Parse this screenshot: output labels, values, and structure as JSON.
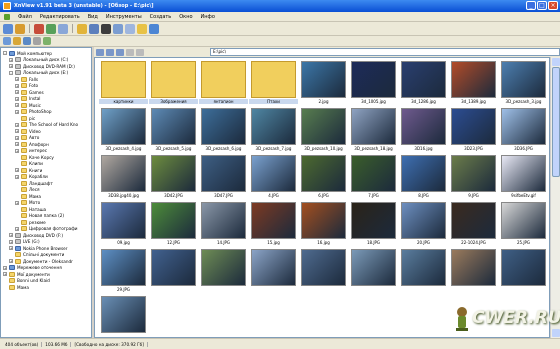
{
  "window": {
    "title": "XnView v1.91 beta 3 (unstable) - [Обзор - E:\\pic\\]"
  },
  "menu": [
    "Файл",
    "Редактировать",
    "Вид",
    "Инструменты",
    "Создать",
    "Окно",
    "Инфо"
  ],
  "address": {
    "value": "E:\\pic\\"
  },
  "tree": [
    {
      "label": "Мой компьютер",
      "depth": 0,
      "kind": "pc",
      "expander": "-"
    },
    {
      "label": "Локальный диск (C:)",
      "depth": 1,
      "kind": "drive",
      "expander": "+"
    },
    {
      "label": "Дисковод DVD-RAM (D:)",
      "depth": 1,
      "kind": "drive",
      "expander": "+"
    },
    {
      "label": "Локальный диск (E:)",
      "depth": 1,
      "kind": "drive",
      "expander": "-"
    },
    {
      "label": "Falls",
      "depth": 2,
      "kind": "folder",
      "expander": "+"
    },
    {
      "label": "Foto",
      "depth": 2,
      "kind": "folder",
      "expander": "+"
    },
    {
      "label": "Games",
      "depth": 2,
      "kind": "folder",
      "expander": "+"
    },
    {
      "label": "Instal",
      "depth": 2,
      "kind": "folder",
      "expander": "+"
    },
    {
      "label": "Music",
      "depth": 2,
      "kind": "folder",
      "expander": "+"
    },
    {
      "label": "PhotoShop",
      "depth": 2,
      "kind": "folder",
      "expander": "+"
    },
    {
      "label": "pic",
      "depth": 2,
      "kind": "folder",
      "expander": ""
    },
    {
      "label": "The School of Hard Kno",
      "depth": 2,
      "kind": "folder",
      "expander": "+"
    },
    {
      "label": "Video",
      "depth": 2,
      "kind": "folder",
      "expander": "+"
    },
    {
      "label": "Авто",
      "depth": 2,
      "kind": "folder",
      "expander": "+"
    },
    {
      "label": "Апофорн",
      "depth": 2,
      "kind": "folder",
      "expander": "+"
    },
    {
      "label": "интерес",
      "depth": 2,
      "kind": "folder",
      "expander": "+"
    },
    {
      "label": "Каче Корсу",
      "depth": 2,
      "kind": "folder",
      "expander": ""
    },
    {
      "label": "Клипи",
      "depth": 2,
      "kind": "folder",
      "expander": ""
    },
    {
      "label": "Книги",
      "depth": 2,
      "kind": "folder",
      "expander": "+"
    },
    {
      "label": "Корабли",
      "depth": 2,
      "kind": "folder",
      "expander": "+"
    },
    {
      "label": "Ландшафт",
      "depth": 2,
      "kind": "folder",
      "expander": ""
    },
    {
      "label": "Леся",
      "depth": 2,
      "kind": "folder",
      "expander": ""
    },
    {
      "label": "Мама",
      "depth": 2,
      "kind": "folder",
      "expander": ""
    },
    {
      "label": "Мото",
      "depth": 2,
      "kind": "folder",
      "expander": "+"
    },
    {
      "label": "Наташа",
      "depth": 2,
      "kind": "folder",
      "expander": ""
    },
    {
      "label": "Новая папка (2)",
      "depth": 2,
      "kind": "folder",
      "expander": ""
    },
    {
      "label": "резюме",
      "depth": 2,
      "kind": "folder",
      "expander": ""
    },
    {
      "label": "Цифровая фотографи",
      "depth": 2,
      "kind": "folder",
      "expander": "+"
    },
    {
      "label": "Дисковод DVD (F:)",
      "depth": 1,
      "kind": "drive",
      "expander": "+"
    },
    {
      "label": "LVE (G:)",
      "depth": 1,
      "kind": "drive",
      "expander": "+"
    },
    {
      "label": "Nokia Phone Browser",
      "depth": 1,
      "kind": "pc",
      "expander": "+"
    },
    {
      "label": "Спільні документи",
      "depth": 1,
      "kind": "folder",
      "expander": ""
    },
    {
      "label": "Документи - Oleksandr",
      "depth": 1,
      "kind": "folder",
      "expander": "+"
    },
    {
      "label": "Мережеве оточення",
      "depth": 0,
      "kind": "pc",
      "expander": "+"
    },
    {
      "label": "Мої документи",
      "depth": 0,
      "kind": "folder",
      "expander": "+"
    },
    {
      "label": "Bonni und Klaid",
      "depth": 0,
      "kind": "folder",
      "expander": ""
    },
    {
      "label": "Мама",
      "depth": 0,
      "kind": "folder",
      "expander": ""
    }
  ],
  "thumbnails": [
    {
      "name": "картинки",
      "dir": true,
      "color": "#f1cf5d"
    },
    {
      "name": "Зображения",
      "dir": true,
      "color": "#f1cf5d"
    },
    {
      "name": "янтапион",
      "dir": true,
      "color": "#f1cf5d"
    },
    {
      "name": "Птахи",
      "dir": true,
      "color": "#f1cf5d"
    },
    {
      "name": "2.jpg",
      "color": "#3c77a8"
    },
    {
      "name": "3d_1005.jpg",
      "color": "#1d2b5a"
    },
    {
      "name": "3d_1286.jpg",
      "color": "#2a3f70"
    },
    {
      "name": "3d_1389.jpg",
      "color": "#b34c28"
    },
    {
      "name": "3D_pezsash_3.jpg",
      "color": "#4d7fb0"
    },
    {
      "name": "3D_pezsash_4.jpg",
      "color": "#6fa0c8"
    },
    {
      "name": "3D_pezsash_5.jpg",
      "color": "#5d8ab5"
    },
    {
      "name": "3D_pezsash_6.jpg",
      "color": "#3d6e9a"
    },
    {
      "name": "3D_pezsash_7.jpg",
      "color": "#4f86a3"
    },
    {
      "name": "3D_pezsash_10.jpg",
      "color": "#587d4f"
    },
    {
      "name": "3D_pezsash_18.jpg",
      "color": "#8fa3c2"
    },
    {
      "name": "3D16.jpg",
      "color": "#6f5a8e"
    },
    {
      "name": "3D23.JPG",
      "color": "#2c4d92"
    },
    {
      "name": "3D36.JPG",
      "color": "#9fc0e8"
    },
    {
      "name": "3D38.jpg40.jpg",
      "color": "#b0a8a0"
    },
    {
      "name": "3D42.JPG",
      "color": "#6d8c3e"
    },
    {
      "name": "3D47.JPG",
      "color": "#3e5f84"
    },
    {
      "name": "4.JPG",
      "color": "#7aa1cf"
    },
    {
      "name": "6.JPG",
      "color": "#4d6a2f"
    },
    {
      "name": "7.JPG",
      "color": "#3b5e2b"
    },
    {
      "name": "8.JPG",
      "color": "#3e6fb2"
    },
    {
      "name": "9.JPG",
      "color": "#6b7c4a"
    },
    {
      "name": "9sifbeEtv.gif",
      "color": "#e9e9f5"
    },
    {
      "name": "09.jpg",
      "color": "#5a78b0"
    },
    {
      "name": "12.JPG",
      "color": "#4d8c3a"
    },
    {
      "name": "14.JPG",
      "color": "#8a97a8"
    },
    {
      "name": "15.jpg",
      "color": "#7d3a22"
    },
    {
      "name": "16.jpg",
      "color": "#a34f1f"
    },
    {
      "name": "18.JPG",
      "color": "#2b2318"
    },
    {
      "name": "20.JPG",
      "color": "#6d8fc0"
    },
    {
      "name": "22-1024.JPG",
      "color": "#3b2a1e"
    },
    {
      "name": "25.JPG",
      "color": "#d8d8d8"
    },
    {
      "name": "29.JPG",
      "color": "#5d8fc4"
    },
    {
      "name": "",
      "color": "#41618f"
    },
    {
      "name": "",
      "color": "#6e8c55"
    },
    {
      "name": "",
      "color": "#8ba4c7"
    },
    {
      "name": "",
      "color": "#4f6b8f"
    },
    {
      "name": "",
      "color": "#7b9ab8"
    },
    {
      "name": "",
      "color": "#5a7d9e"
    },
    {
      "name": "",
      "color": "#9a7a5c"
    },
    {
      "name": "",
      "color": "#3f5f85"
    },
    {
      "name": "",
      "color": "#6a8fb5"
    }
  ],
  "status": {
    "count": "404 объект(ов)",
    "size": "103.66 Мб",
    "free": "[Свободно на диске: 370.92 Гб]"
  },
  "watermark": {
    "text": "CWER.RU"
  }
}
